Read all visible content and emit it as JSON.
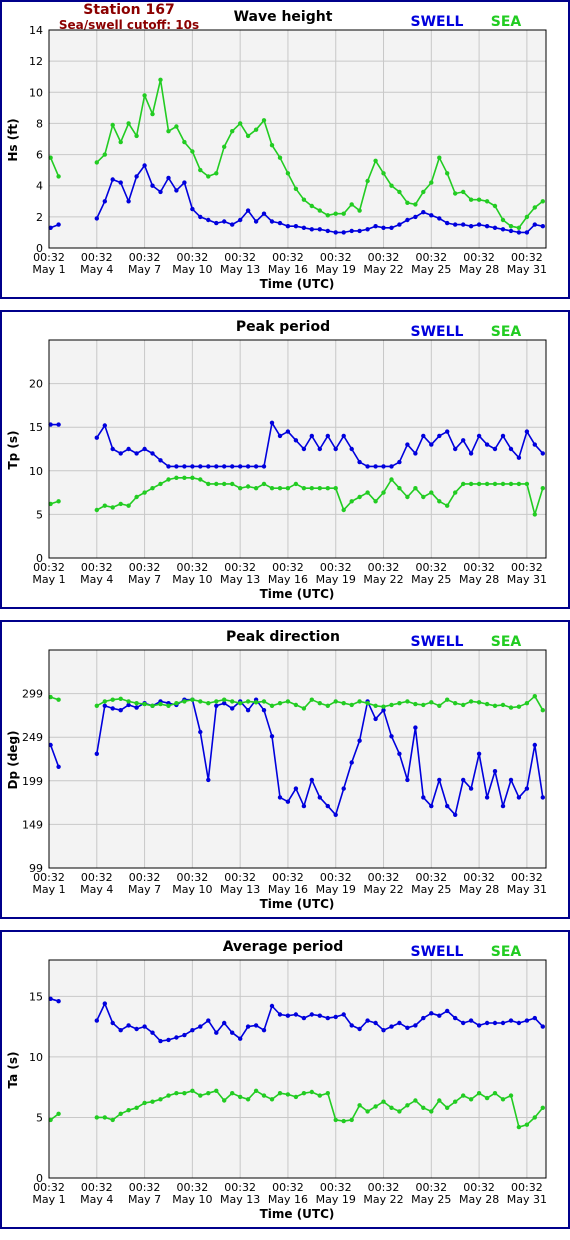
{
  "header": {
    "station": "Station 167",
    "cutoff": "Sea/swell cutoff: 10s"
  },
  "legend": {
    "swell": "SWELL",
    "sea": "SEA"
  },
  "colors": {
    "swell": "#0000dd",
    "sea": "#22cc22",
    "header_text": "#8b0000",
    "frame": "#00008b",
    "plot_bg": "#f3f3f3",
    "grid": "#c8c8c8"
  },
  "x_axis": {
    "title": "Time (UTC)",
    "ticks": [
      {
        "day": 1,
        "time": "00:32",
        "date": "May 1"
      },
      {
        "day": 4,
        "time": "00:32",
        "date": "May 4"
      },
      {
        "day": 7,
        "time": "00:32",
        "date": "May 7"
      },
      {
        "day": 10,
        "time": "00:32",
        "date": "May 10"
      },
      {
        "day": 13,
        "time": "00:32",
        "date": "May 13"
      },
      {
        "day": 16,
        "time": "00:32",
        "date": "May 16"
      },
      {
        "day": 19,
        "time": "00:32",
        "date": "May 19"
      },
      {
        "day": 22,
        "time": "00:32",
        "date": "May 22"
      },
      {
        "day": 25,
        "time": "00:32",
        "date": "May 25"
      },
      {
        "day": 28,
        "time": "00:32",
        "date": "May 28"
      },
      {
        "day": 31,
        "time": "00:32",
        "date": "May 31"
      }
    ],
    "range": [
      1,
      32.2
    ]
  },
  "chart_data": [
    {
      "type": "line",
      "title": "Wave height",
      "ylabel": "Hs (ft)",
      "xlabel": "Time (UTC)",
      "ylim": [
        0,
        14
      ],
      "yticks": [
        0,
        2,
        4,
        6,
        8,
        10,
        12,
        14
      ],
      "grid": true,
      "legend": "top-right",
      "x": [
        1.1,
        1.6,
        4.0,
        4.5,
        5.0,
        5.5,
        6.0,
        6.5,
        7.0,
        7.5,
        8.0,
        8.5,
        9.0,
        9.5,
        10.0,
        10.5,
        11.0,
        11.5,
        12.0,
        12.5,
        13.0,
        13.5,
        14.0,
        14.5,
        15.0,
        15.5,
        16.0,
        16.5,
        17.0,
        17.5,
        18.0,
        18.5,
        19.0,
        19.5,
        20.0,
        20.5,
        21.0,
        21.5,
        22.0,
        22.5,
        23.0,
        23.5,
        24.0,
        24.5,
        25.0,
        25.5,
        26.0,
        26.5,
        27.0,
        27.5,
        28.0,
        28.5,
        29.0,
        29.5,
        30.0,
        30.5,
        31.0,
        31.5,
        32.0
      ],
      "series": [
        {
          "name": "SWELL",
          "color": "#0000dd",
          "values": [
            1.3,
            1.5,
            1.9,
            3.0,
            4.4,
            4.2,
            3.0,
            4.6,
            5.3,
            4.0,
            3.6,
            4.5,
            3.7,
            4.2,
            2.5,
            2.0,
            1.8,
            1.6,
            1.7,
            1.5,
            1.8,
            2.4,
            1.7,
            2.2,
            1.7,
            1.6,
            1.4,
            1.4,
            1.3,
            1.2,
            1.2,
            1.1,
            1.0,
            1.0,
            1.1,
            1.1,
            1.2,
            1.4,
            1.3,
            1.3,
            1.5,
            1.8,
            2.0,
            2.3,
            2.1,
            1.9,
            1.6,
            1.5,
            1.5,
            1.4,
            1.5,
            1.4,
            1.3,
            1.2,
            1.1,
            1.0,
            1.0,
            1.5,
            1.4
          ]
        },
        {
          "name": "SEA",
          "color": "#22cc22",
          "values": [
            5.8,
            4.6,
            5.5,
            6.0,
            7.9,
            6.8,
            8.0,
            7.2,
            9.8,
            8.6,
            10.8,
            7.5,
            7.8,
            6.8,
            6.2,
            5.0,
            4.6,
            4.8,
            6.5,
            7.5,
            8.0,
            7.2,
            7.6,
            8.2,
            6.6,
            5.8,
            4.8,
            3.8,
            3.1,
            2.7,
            2.4,
            2.1,
            2.2,
            2.2,
            2.8,
            2.4,
            4.3,
            5.6,
            4.8,
            4.0,
            3.6,
            2.9,
            2.8,
            3.6,
            4.2,
            5.8,
            4.8,
            3.5,
            3.6,
            3.1,
            3.1,
            3.0,
            2.7,
            1.8,
            1.4,
            1.3,
            2.0,
            2.6,
            3.0
          ]
        }
      ]
    },
    {
      "type": "line",
      "title": "Peak period",
      "ylabel": "Tp (s)",
      "xlabel": "Time (UTC)",
      "ylim": [
        0,
        25
      ],
      "yticks": [
        0,
        5,
        10,
        15,
        20
      ],
      "grid": true,
      "legend": "top-right",
      "x": [
        1.1,
        1.6,
        4.0,
        4.5,
        5.0,
        5.5,
        6.0,
        6.5,
        7.0,
        7.5,
        8.0,
        8.5,
        9.0,
        9.5,
        10.0,
        10.5,
        11.0,
        11.5,
        12.0,
        12.5,
        13.0,
        13.5,
        14.0,
        14.5,
        15.0,
        15.5,
        16.0,
        16.5,
        17.0,
        17.5,
        18.0,
        18.5,
        19.0,
        19.5,
        20.0,
        20.5,
        21.0,
        21.5,
        22.0,
        22.5,
        23.0,
        23.5,
        24.0,
        24.5,
        25.0,
        25.5,
        26.0,
        26.5,
        27.0,
        27.5,
        28.0,
        28.5,
        29.0,
        29.5,
        30.0,
        30.5,
        31.0,
        31.5,
        32.0
      ],
      "series": [
        {
          "name": "SWELL",
          "color": "#0000dd",
          "values": [
            15.3,
            15.3,
            13.8,
            15.2,
            12.5,
            12.0,
            12.5,
            12.0,
            12.5,
            12.0,
            11.2,
            10.5,
            10.5,
            10.5,
            10.5,
            10.5,
            10.5,
            10.5,
            10.5,
            10.5,
            10.5,
            10.5,
            10.5,
            10.5,
            15.5,
            14.0,
            14.5,
            13.5,
            12.5,
            14.0,
            12.5,
            14.0,
            12.5,
            14.0,
            12.5,
            11.0,
            10.5,
            10.5,
            10.5,
            10.5,
            11.0,
            13.0,
            12.0,
            14.0,
            13.0,
            14.0,
            14.5,
            12.5,
            13.5,
            12.0,
            14.0,
            13.0,
            12.5,
            14.0,
            12.5,
            11.5,
            14.5,
            13.0,
            12.0
          ]
        },
        {
          "name": "SEA",
          "color": "#22cc22",
          "values": [
            6.2,
            6.5,
            5.5,
            6.0,
            5.8,
            6.2,
            6.0,
            7.0,
            7.5,
            8.0,
            8.5,
            9.0,
            9.2,
            9.2,
            9.2,
            9.0,
            8.5,
            8.5,
            8.5,
            8.5,
            8.0,
            8.2,
            8.0,
            8.5,
            8.0,
            8.0,
            8.0,
            8.5,
            8.0,
            8.0,
            8.0,
            8.0,
            8.0,
            5.5,
            6.5,
            7.0,
            7.5,
            6.5,
            7.5,
            9.0,
            8.0,
            7.0,
            8.0,
            7.0,
            7.5,
            6.5,
            6.0,
            7.5,
            8.5,
            8.5,
            8.5,
            8.5,
            8.5,
            8.5,
            8.5,
            8.5,
            8.5,
            5.0,
            8.0
          ]
        }
      ]
    },
    {
      "type": "line",
      "title": "Peak direction",
      "ylabel": "Dp (deg)",
      "xlabel": "Time (UTC)",
      "ylim": [
        99,
        349
      ],
      "yticks": [
        99,
        149,
        199,
        249,
        299
      ],
      "grid": true,
      "legend": "top-right",
      "x": [
        1.1,
        1.6,
        4.0,
        4.5,
        5.0,
        5.5,
        6.0,
        6.5,
        7.0,
        7.5,
        8.0,
        8.5,
        9.0,
        9.5,
        10.0,
        10.5,
        11.0,
        11.5,
        12.0,
        12.5,
        13.0,
        13.5,
        14.0,
        14.5,
        15.0,
        15.5,
        16.0,
        16.5,
        17.0,
        17.5,
        18.0,
        18.5,
        19.0,
        19.5,
        20.0,
        20.5,
        21.0,
        21.5,
        22.0,
        22.5,
        23.0,
        23.5,
        24.0,
        24.5,
        25.0,
        25.5,
        26.0,
        26.5,
        27.0,
        27.5,
        28.0,
        28.5,
        29.0,
        29.5,
        30.0,
        30.5,
        31.0,
        31.5,
        32.0
      ],
      "series": [
        {
          "name": "SWELL",
          "color": "#0000dd",
          "values": [
            240,
            215,
            230,
            285,
            282,
            280,
            286,
            283,
            288,
            285,
            290,
            288,
            286,
            292,
            292,
            255,
            200,
            285,
            288,
            282,
            290,
            280,
            292,
            280,
            250,
            180,
            175,
            190,
            170,
            200,
            180,
            170,
            160,
            190,
            220,
            245,
            290,
            270,
            280,
            250,
            230,
            200,
            260,
            180,
            170,
            200,
            170,
            160,
            200,
            190,
            230,
            180,
            210,
            170,
            200,
            180,
            190,
            240,
            180
          ]
        },
        {
          "name": "SEA",
          "color": "#22cc22",
          "values": [
            295,
            292,
            285,
            290,
            292,
            293,
            290,
            288,
            287,
            285,
            287,
            285,
            288,
            290,
            292,
            290,
            288,
            290,
            292,
            290,
            288,
            290,
            289,
            290,
            285,
            288,
            290,
            286,
            282,
            292,
            288,
            285,
            290,
            288,
            286,
            290,
            288,
            285,
            284,
            286,
            288,
            290,
            287,
            286,
            289,
            285,
            292,
            288,
            286,
            290,
            289,
            287,
            285,
            286,
            283,
            284,
            288,
            296,
            280
          ]
        }
      ]
    },
    {
      "type": "line",
      "title": "Average period",
      "ylabel": "Ta (s)",
      "xlabel": "Time (UTC)",
      "ylim": [
        0,
        18
      ],
      "yticks": [
        0,
        5,
        10,
        15
      ],
      "grid": true,
      "legend": "top-right",
      "x": [
        1.1,
        1.6,
        4.0,
        4.5,
        5.0,
        5.5,
        6.0,
        6.5,
        7.0,
        7.5,
        8.0,
        8.5,
        9.0,
        9.5,
        10.0,
        10.5,
        11.0,
        11.5,
        12.0,
        12.5,
        13.0,
        13.5,
        14.0,
        14.5,
        15.0,
        15.5,
        16.0,
        16.5,
        17.0,
        17.5,
        18.0,
        18.5,
        19.0,
        19.5,
        20.0,
        20.5,
        21.0,
        21.5,
        22.0,
        22.5,
        23.0,
        23.5,
        24.0,
        24.5,
        25.0,
        25.5,
        26.0,
        26.5,
        27.0,
        27.5,
        28.0,
        28.5,
        29.0,
        29.5,
        30.0,
        30.5,
        31.0,
        31.5,
        32.0
      ],
      "series": [
        {
          "name": "SWELL",
          "color": "#0000dd",
          "values": [
            14.8,
            14.6,
            13.0,
            14.4,
            12.8,
            12.2,
            12.6,
            12.3,
            12.5,
            12.0,
            11.3,
            11.4,
            11.6,
            11.8,
            12.2,
            12.5,
            13.0,
            12.0,
            12.8,
            12.0,
            11.5,
            12.5,
            12.6,
            12.2,
            14.2,
            13.5,
            13.4,
            13.5,
            13.2,
            13.5,
            13.4,
            13.2,
            13.3,
            13.5,
            12.6,
            12.3,
            13.0,
            12.8,
            12.2,
            12.5,
            12.8,
            12.4,
            12.6,
            13.2,
            13.6,
            13.4,
            13.8,
            13.2,
            12.8,
            13.0,
            12.6,
            12.8,
            12.8,
            12.8,
            13.0,
            12.8,
            13.0,
            13.2,
            12.5
          ]
        },
        {
          "name": "SEA",
          "color": "#22cc22",
          "values": [
            4.8,
            5.3,
            5.0,
            5.0,
            4.8,
            5.3,
            5.6,
            5.8,
            6.2,
            6.3,
            6.5,
            6.8,
            7.0,
            7.0,
            7.2,
            6.8,
            7.0,
            7.2,
            6.4,
            7.0,
            6.7,
            6.5,
            7.2,
            6.8,
            6.5,
            7.0,
            6.9,
            6.7,
            7.0,
            7.1,
            6.8,
            7.0,
            4.8,
            4.7,
            4.8,
            6.0,
            5.5,
            5.9,
            6.3,
            5.8,
            5.5,
            6.0,
            6.4,
            5.8,
            5.5,
            6.4,
            5.8,
            6.3,
            6.8,
            6.5,
            7.0,
            6.6,
            7.0,
            6.5,
            6.8,
            4.2,
            4.4,
            5.0,
            5.8
          ]
        }
      ]
    }
  ]
}
